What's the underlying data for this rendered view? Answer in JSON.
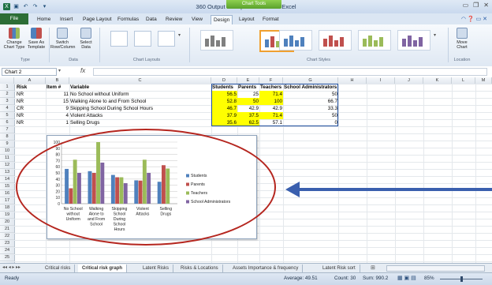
{
  "window": {
    "title": "360 Output for report - Microsoft Excel",
    "contextual_label": "Chart Tools"
  },
  "tabs": [
    {
      "label": "File"
    },
    {
      "label": "Home"
    },
    {
      "label": "Insert"
    },
    {
      "label": "Page Layout"
    },
    {
      "label": "Formulas"
    },
    {
      "label": "Data"
    },
    {
      "label": "Review"
    },
    {
      "label": "View"
    },
    {
      "label": "Design"
    },
    {
      "label": "Layout"
    },
    {
      "label": "Format"
    }
  ],
  "ribbon": {
    "change_chart_type": "Change Chart Type",
    "save_as_template": "Save As Template",
    "switch_row_column": "Switch Row/Column",
    "select_data": "Select Data",
    "move_chart": "Move Chart",
    "groups": {
      "type": "Type",
      "data": "Data",
      "layouts": "Chart Layouts",
      "styles": "Chart Styles",
      "location": "Location"
    }
  },
  "formula_bar": {
    "name_box": "Chart 2",
    "fx": "fx"
  },
  "columns": [
    "A",
    "B",
    "C",
    "D",
    "E",
    "F",
    "G",
    "H",
    "I",
    "J",
    "K",
    "L",
    "M"
  ],
  "rows": [
    "1",
    "2",
    "3",
    "4",
    "5",
    "6",
    "7",
    "8",
    "9",
    "10",
    "11",
    "12",
    "13",
    "14",
    "15",
    "16",
    "17",
    "18",
    "19",
    "20",
    "21",
    "22",
    "23",
    "24",
    "25"
  ],
  "table": {
    "headers": [
      "Risk",
      "Item #",
      "Variable",
      "Students",
      "Parents",
      "Teachers",
      "School Administrators"
    ],
    "rows": [
      {
        "risk": "NR",
        "item": "11",
        "variable": "No School without Uniform",
        "students": "56.5",
        "parents": "25",
        "teachers": "71.4",
        "admins": "50"
      },
      {
        "risk": "NR",
        "item": "15",
        "variable": "Walking Alone to and From School",
        "students": "52.8",
        "parents": "50",
        "teachers": "100",
        "admins": "66.7"
      },
      {
        "risk": "CR",
        "item": "9",
        "variable": "Skipping School During School Hours",
        "students": "46.7",
        "parents": "42.9",
        "teachers": "42.9",
        "admins": "33.3"
      },
      {
        "risk": "NR",
        "item": "4",
        "variable": "Violent Attacks",
        "students": "37.9",
        "parents": "37.5",
        "teachers": "71.4",
        "admins": "50"
      },
      {
        "risk": "NR",
        "item": "1",
        "variable": "Selling Drugs",
        "students": "35.6",
        "parents": "62.5",
        "teachers": "57.1",
        "admins": "0"
      }
    ]
  },
  "chart_data": {
    "type": "bar",
    "categories": [
      "No School without Uniform",
      "Walking Alone to and From School",
      "Skipping School During School Hours",
      "Violent Attacks",
      "Selling Drugs"
    ],
    "category_labels": [
      [
        "No School",
        "without",
        "Uniform"
      ],
      [
        "Walking",
        "Alone to",
        "and From",
        "School"
      ],
      [
        "Skipping",
        "School",
        "During",
        "School",
        "Hours"
      ],
      [
        "Violent",
        "Attacks"
      ],
      [
        "Selling",
        "Drugs"
      ]
    ],
    "series": [
      {
        "name": "Students",
        "values": [
          56.5,
          52.8,
          46.7,
          37.9,
          35.6
        ]
      },
      {
        "name": "Parents",
        "values": [
          25,
          50,
          42.9,
          37.5,
          62.5
        ]
      },
      {
        "name": "Teachers",
        "values": [
          71.4,
          100,
          42.9,
          71.4,
          57.1
        ]
      },
      {
        "name": "School Administrators",
        "values": [
          50,
          66.7,
          33.3,
          50,
          0
        ]
      }
    ],
    "ylim": [
      0,
      100
    ],
    "yticks": [
      0,
      10,
      20,
      30,
      40,
      50,
      60,
      70,
      80,
      90,
      100
    ],
    "grid": true,
    "legend": "right",
    "colors": [
      "#4f81bd",
      "#c0504d",
      "#9bbb59",
      "#8064a2"
    ]
  },
  "sheet_tabs": [
    "Critical risks",
    "Critical risk graph",
    "Latent Risks",
    "Risks & Locations",
    "Assets Importance & frequency",
    "Latent Risk sort"
  ],
  "active_sheet": "Critical risk graph",
  "status": {
    "ready": "Ready",
    "average": "Average: 49.51",
    "count": "Count: 30",
    "sum": "Sum: 990.2",
    "zoom": "85%"
  },
  "annotation_color": "#3a5fae"
}
